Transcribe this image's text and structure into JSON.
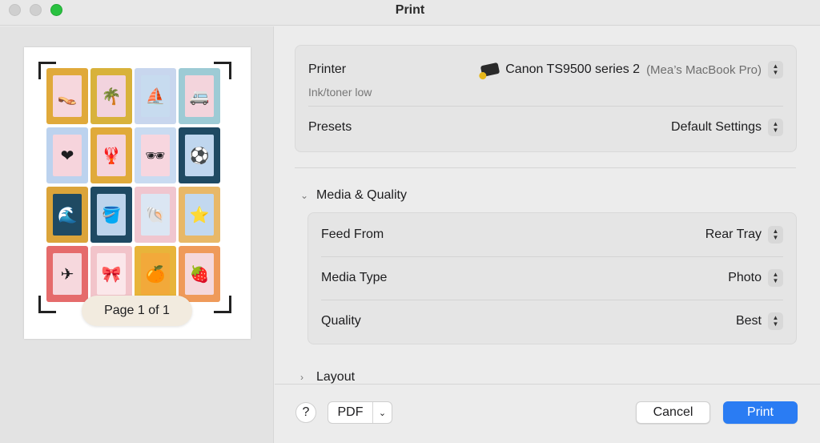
{
  "window": {
    "title": "Print"
  },
  "preview": {
    "page_indicator": "Page 1 of 1",
    "stamps": [
      {
        "icon": "flip-flops-icon",
        "glyph": "👡",
        "frame": "#e0a93a",
        "inner": "#f6d7dd"
      },
      {
        "icon": "palm-tree-icon",
        "glyph": "🌴",
        "frame": "#d8b23b",
        "inner": "#f2d3de"
      },
      {
        "icon": "sailboat-icon",
        "glyph": "⛵",
        "frame": "#c8d6ee",
        "inner": "#c7dbef"
      },
      {
        "icon": "camper-van-icon",
        "glyph": "🚐",
        "frame": "#9dcbd5",
        "inner": "#f3d4dc"
      },
      {
        "icon": "heart-icon",
        "glyph": "❤",
        "frame": "#bcd2ee",
        "inner": "#f6d4dc"
      },
      {
        "icon": "lobster-icon",
        "glyph": "🦞",
        "frame": "#e0aa3a",
        "inner": "#f5d4dc"
      },
      {
        "icon": "sunglasses-icon",
        "glyph": "🕶",
        "frame": "#c9dbf1",
        "inner": "#f7d6df"
      },
      {
        "icon": "beach-ball-icon",
        "glyph": "⚽",
        "frame": "#1f4a63",
        "inner": "#bfd6ee"
      },
      {
        "icon": "wave-icon",
        "glyph": "🌊",
        "frame": "#dba43a",
        "inner": "#1f4a63"
      },
      {
        "icon": "sand-bucket-icon",
        "glyph": "🪣",
        "frame": "#1f4a63",
        "inner": "#bdd4ec"
      },
      {
        "icon": "seashell-icon",
        "glyph": "🐚",
        "frame": "#f0c6cf",
        "inner": "#dbe6f3"
      },
      {
        "icon": "starfish-icon",
        "glyph": "⭐",
        "frame": "#e8b868",
        "inner": "#c2d8ef"
      },
      {
        "icon": "airplane-icon",
        "glyph": "✈",
        "frame": "#e56b6b",
        "inner": "#f6d8dd"
      },
      {
        "icon": "bow-icon",
        "glyph": "🎀",
        "frame": "#f2c4ca",
        "inner": "#fbe7ea"
      },
      {
        "icon": "orange-slice-icon",
        "glyph": "🍊",
        "frame": "#e8b43a",
        "inner": "#f2a93a"
      },
      {
        "icon": "strawberry-icon",
        "glyph": "🍓",
        "frame": "#ef9a5a",
        "inner": "#f5d8dc"
      }
    ]
  },
  "printer_group": {
    "printer_label": "Printer",
    "printer_name": "Canon TS9500 series 2",
    "printer_host": "(Mea’s MacBook Pro)",
    "printer_status": "Ink/toner low",
    "presets_label": "Presets",
    "presets_value": "Default Settings"
  },
  "media_quality": {
    "section_title": "Media & Quality",
    "feed_from_label": "Feed From",
    "feed_from_value": "Rear Tray",
    "media_type_label": "Media Type",
    "media_type_value": "Photo",
    "quality_label": "Quality",
    "quality_value": "Best"
  },
  "layout_section": {
    "section_title": "Layout"
  },
  "footer": {
    "help_label": "?",
    "pdf_label": "PDF",
    "cancel_label": "Cancel",
    "print_label": "Print"
  },
  "colors": {
    "accent": "#2a7cf3",
    "zoom_green": "#29c140"
  }
}
